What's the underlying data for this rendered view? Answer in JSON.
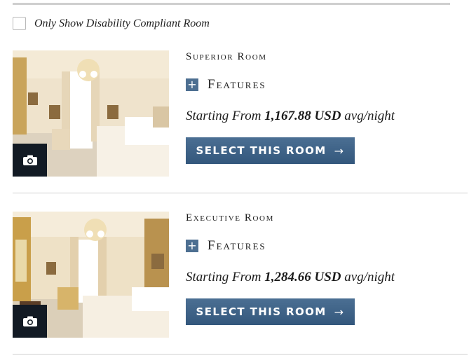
{
  "filter": {
    "label": "Only Show Disability Compliant Room",
    "checked": false
  },
  "rooms": [
    {
      "title": "Superior Room",
      "features_label": "Features",
      "features_icon": "+",
      "price_prefix": "Starting From",
      "price_amount": "1,167.88 USD",
      "price_suffix": "avg/night",
      "button_label": "SELECT THIS ROOM",
      "button_arrow": "→",
      "photo_icon": "camera-icon"
    },
    {
      "title": "Executive Room",
      "features_label": "Features",
      "features_icon": "+",
      "price_prefix": "Starting From",
      "price_amount": "1,284.66 USD",
      "price_suffix": "avg/night",
      "button_label": "SELECT THIS ROOM",
      "button_arrow": "→",
      "photo_icon": "camera-icon"
    }
  ],
  "colors": {
    "accent": "#3f6388",
    "button_dark": "#33577c",
    "camera_bg": "#121a24",
    "divider": "#cfcfcf"
  }
}
